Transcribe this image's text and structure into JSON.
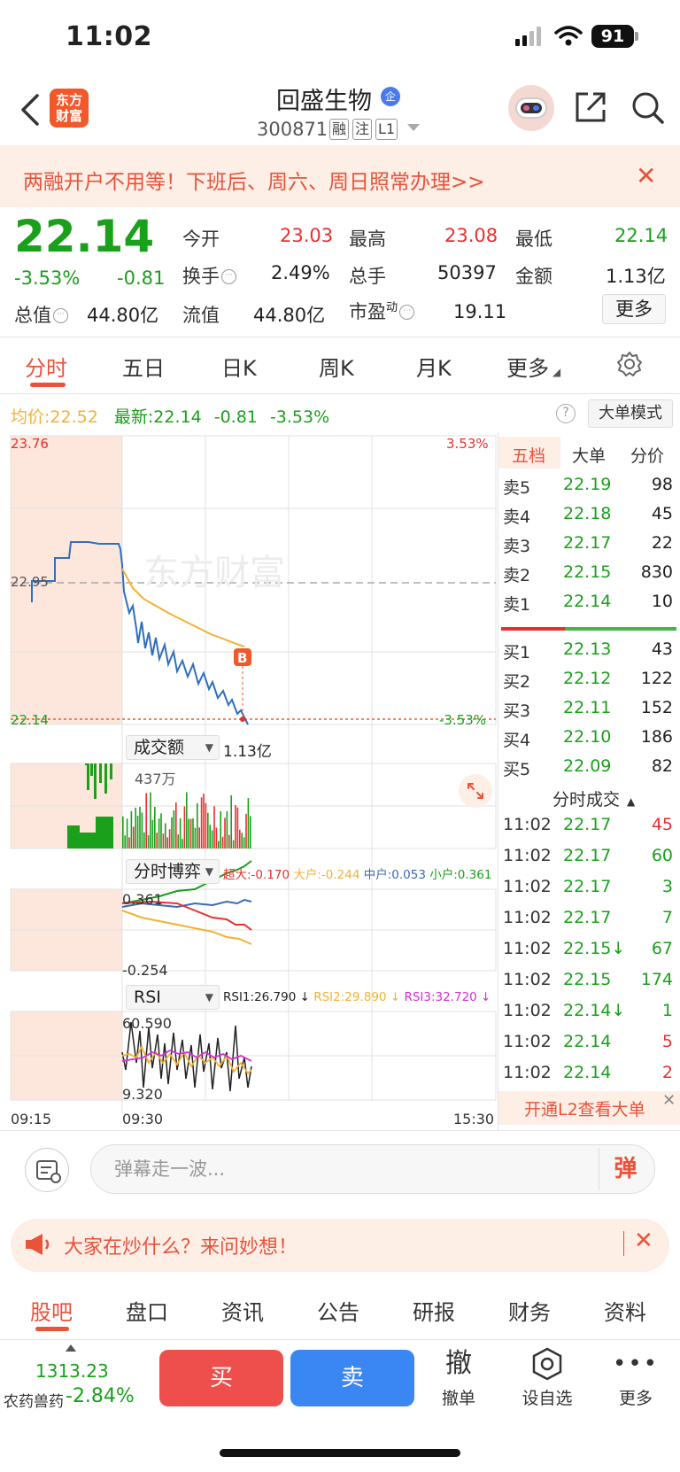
{
  "status_bar": {
    "time": "11:02",
    "battery": "91"
  },
  "header": {
    "logo_text": "东方财富",
    "stock_name": "回盛生物",
    "ent_badge": "企",
    "stock_code": "300871",
    "tags": [
      "融",
      "注",
      "L1"
    ]
  },
  "banner": {
    "text": "两融开户不用等！下班后、周六、周日照常办理>>"
  },
  "quote": {
    "price": "22.14",
    "change_pct": "-3.53%",
    "change": "-0.81",
    "open_label": "今开",
    "open": "23.03",
    "high_label": "最高",
    "high": "23.08",
    "low_label": "最低",
    "low": "22.14",
    "turnover_label": "换手",
    "turnover": "2.49%",
    "volume_label": "总手",
    "volume": "50397",
    "amount_label": "金额",
    "amount": "1.13亿",
    "mktcap_label": "总值",
    "mktcap": "44.80亿",
    "float_label": "流值",
    "float_cap": "44.80亿",
    "pe_label": "市盈",
    "pe_sup": "动",
    "pe": "19.11",
    "more_label": "更多"
  },
  "tabs": [
    "分时",
    "五日",
    "日K",
    "周K",
    "月K",
    "更多"
  ],
  "summary": {
    "avg_label": "均价:",
    "avg": "22.52",
    "latest_label": "最新:",
    "latest": "22.14",
    "chg": "-0.81",
    "pct": "-3.53%",
    "big_mode": "大单模式"
  },
  "chart": {
    "y_top": "23.76",
    "y_mid": "22.95",
    "y_bottom": "22.14",
    "pct_top": "3.53%",
    "pct_bottom": "-3.53%",
    "watermark": "东方财富",
    "b_marker": "B",
    "volume_selector": "成交额",
    "volume_total": "1.13亿",
    "volume_max": "437万",
    "flow_selector": "分时博弈",
    "flow_legend": {
      "super": "超大:-0.170",
      "large": "大户:-0.244",
      "mid": "中户:0.053",
      "small": "小户:0.361"
    },
    "flow_top": "0.361",
    "flow_bottom": "-0.254",
    "rsi_selector": "RSI",
    "rsi_legend": {
      "rsi1": "RSI1:26.790 ↓",
      "rsi2": "RSI2:29.890 ↓",
      "rsi3": "RSI3:32.720 ↓"
    },
    "rsi_top": "60.590",
    "rsi_bottom": "9.320",
    "time_start": "09:15",
    "time_open": "09:30",
    "time_end": "15:30",
    "colors": {
      "price": "#2f6fbf",
      "avg": "#f2b233",
      "up": "#e8302f",
      "down": "#1aa01a"
    }
  },
  "chart_data": {
    "type": "line",
    "ylim": [
      22.14,
      23.76
    ],
    "series": [
      {
        "name": "最新",
        "values": [
          22.95,
          23.21,
          23.29,
          23.28,
          23.26,
          22.95,
          22.9,
          22.84,
          22.78,
          22.71,
          22.64,
          22.55,
          22.47,
          22.4,
          22.33,
          22.26,
          22.14
        ]
      },
      {
        "name": "均价",
        "values": [
          22.95,
          22.88,
          22.82,
          22.77,
          22.72,
          22.67,
          22.63,
          22.59,
          22.55,
          22.52
        ]
      }
    ]
  },
  "order_book": {
    "tabs": [
      "五档",
      "大单",
      "分价"
    ],
    "asks": [
      {
        "label": "卖5",
        "price": "22.19",
        "vol": "98"
      },
      {
        "label": "卖4",
        "price": "22.18",
        "vol": "45"
      },
      {
        "label": "卖3",
        "price": "22.17",
        "vol": "22"
      },
      {
        "label": "卖2",
        "price": "22.15",
        "vol": "830"
      },
      {
        "label": "卖1",
        "price": "22.14",
        "vol": "10"
      }
    ],
    "bids": [
      {
        "label": "买1",
        "price": "22.13",
        "vol": "43"
      },
      {
        "label": "买2",
        "price": "22.12",
        "vol": "122"
      },
      {
        "label": "买3",
        "price": "22.11",
        "vol": "152"
      },
      {
        "label": "买4",
        "price": "22.10",
        "vol": "186"
      },
      {
        "label": "买5",
        "price": "22.09",
        "vol": "82"
      }
    ],
    "ticks_title": "分时成交",
    "ticks": [
      {
        "time": "11:02",
        "price": "22.17",
        "vol": "45",
        "side": "red"
      },
      {
        "time": "11:02",
        "price": "22.17",
        "vol": "60",
        "side": "green"
      },
      {
        "time": "11:02",
        "price": "22.17",
        "vol": "3",
        "side": "green"
      },
      {
        "time": "11:02",
        "price": "22.17",
        "vol": "7",
        "side": "green"
      },
      {
        "time": "11:02",
        "price": "22.15↓",
        "vol": "67",
        "side": "green"
      },
      {
        "time": "11:02",
        "price": "22.15",
        "vol": "174",
        "side": "green"
      },
      {
        "time": "11:02",
        "price": "22.14↓",
        "vol": "1",
        "side": "green"
      },
      {
        "time": "11:02",
        "price": "22.14",
        "vol": "5",
        "side": "red"
      },
      {
        "time": "11:02",
        "price": "22.14",
        "vol": "2",
        "side": "red"
      }
    ],
    "l2_text": "开通L2查看大单"
  },
  "comment": {
    "placeholder": "弹幕走一波...",
    "danmu": "弹"
  },
  "ad": {
    "text": "大家在炒什么？来问妙想！"
  },
  "bottom_tabs": [
    "股吧",
    "盘口",
    "资讯",
    "公告",
    "研报",
    "财务",
    "资料"
  ],
  "footer": {
    "index_value": "1313.23",
    "index_name": "农药兽药",
    "index_pct": "-2.84%",
    "buy": "买",
    "sell": "卖",
    "cancel_icon": "撤",
    "cancel": "撤单",
    "watch": "设自选",
    "more": "更多"
  }
}
